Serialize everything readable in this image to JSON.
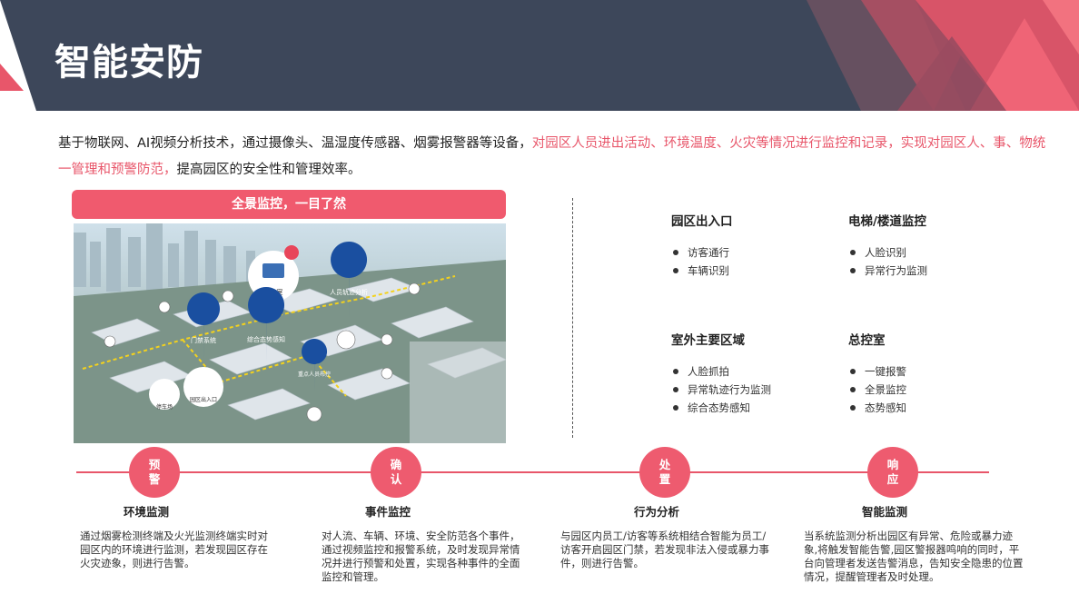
{
  "header": {
    "title": "智能安防"
  },
  "intro": {
    "part1": "基于物联网、AI视频分析技术，通过摄像头、温湿度传感器、烟雾报警器等设备，",
    "highlight": "对园区人员进出活动、环境温度、火灾等情况进行监控和记录，实现对园区人、事、物统一管理和预警防范，",
    "part2": "提高园区的安全性和管理效率。"
  },
  "banner": "全景监控，一目了然",
  "map_labels": {
    "control_room": "总控室",
    "personnel": "人员轨迹分析",
    "access": "门禁系统",
    "situation": "综合态势感知",
    "key_personnel": "重点人员布控",
    "gate": "园区出入口",
    "parking": "停车场"
  },
  "features": [
    {
      "title": "园区出入口",
      "items": [
        "访客通行",
        "车辆识别"
      ]
    },
    {
      "title": "电梯/楼道监控",
      "items": [
        "人脸识别",
        "异常行为监测"
      ]
    },
    {
      "title": "室外主要区域",
      "items": [
        "人脸抓拍",
        "异常轨迹行为监测",
        "综合态势感知"
      ]
    },
    {
      "title": "总控室",
      "items": [
        "一键报警",
        "全景监控",
        "态势感知"
      ]
    }
  ],
  "steps": [
    {
      "node": "预警",
      "title": "环境监测",
      "desc": "通过烟雾检测终端及火光监测终端实时对园区内的环境进行监测，若发现园区存在火灾迹象，则进行告警。"
    },
    {
      "node": "确认",
      "title": "事件监控",
      "desc": "对人流、车辆、环境、安全防范各个事件，通过视频监控和报警系统，及时发现异常情况并进行预警和处置，实现各种事件的全面监控和管理。"
    },
    {
      "node": "处置",
      "title": "行为分析",
      "desc": "与园区内员工/访客等系统相结合智能为员工/访客开启园区门禁，若发现非法入侵或暴力事件，则进行告警。"
    },
    {
      "node": "响应",
      "title": "智能监测",
      "desc": "当系统监测分析出园区有异常、危险或暴力迹象,将触发智能告警,园区警报器鸣响的同时，平台向管理者发送告警消息，告知安全隐患的位置情况，提醒管理者及时处理。"
    }
  ],
  "colors": {
    "accent": "#e8566a",
    "header_bg": "#3d475a",
    "pin_blue": "#1a4fa0"
  }
}
